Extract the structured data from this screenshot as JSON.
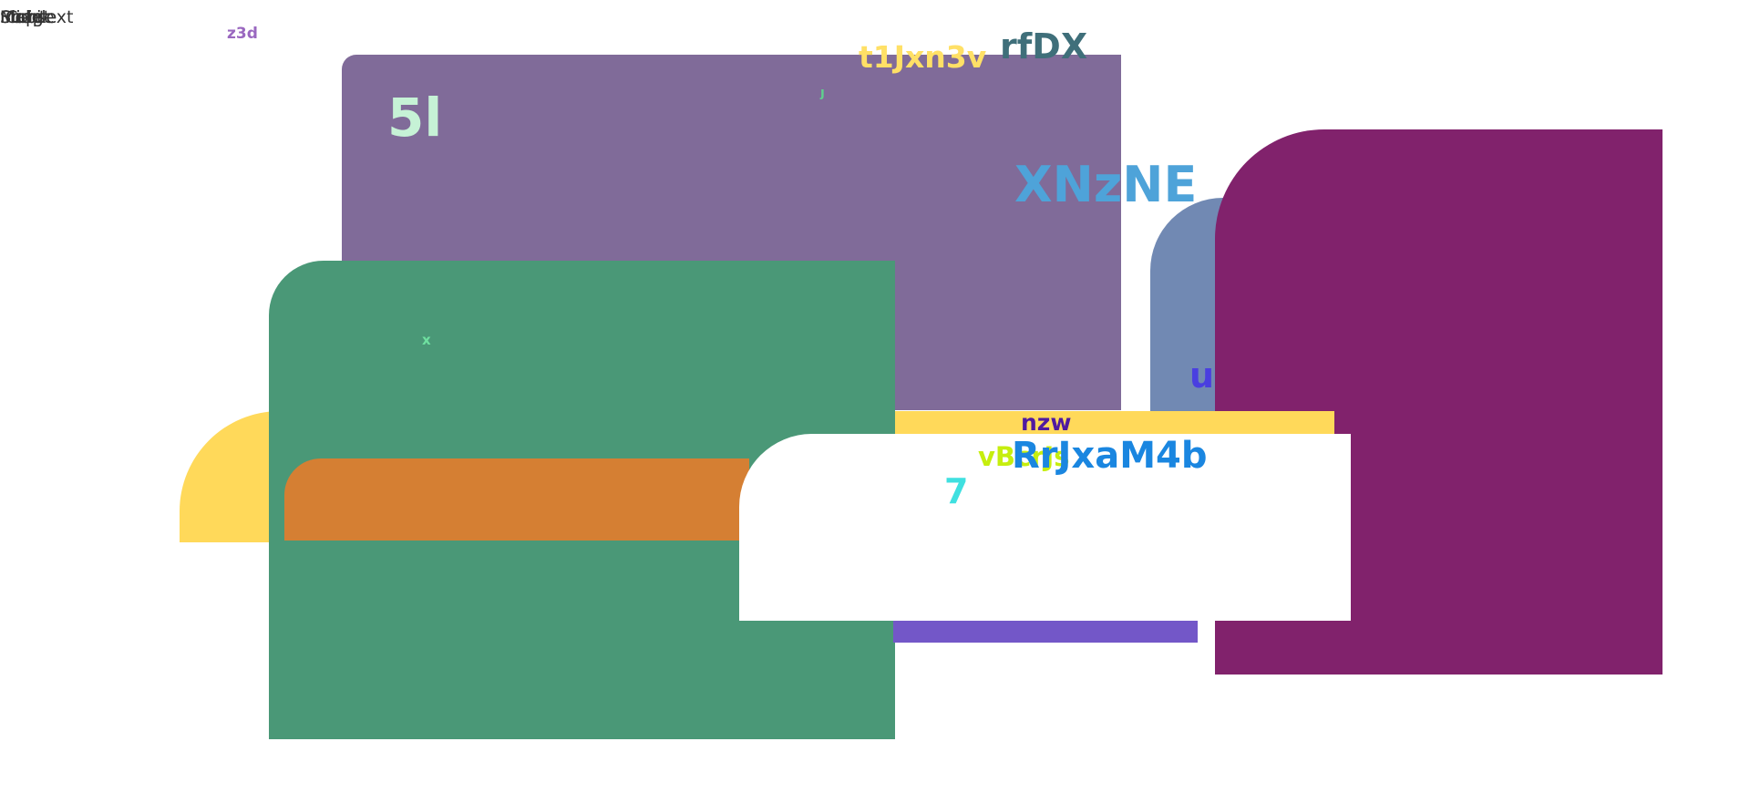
{
  "overlapping_labels": [
    "Image",
    "Maps",
    "Script",
    "Mobile",
    "Slide",
    "Context"
  ],
  "shape_colors": {
    "purple_panel": "#806b99",
    "steel_blue_panel": "#7189b3",
    "magenta_panel": "#81226c",
    "yellow_strip": "#ffd95a",
    "yellow_left": "#ffd95a",
    "green_panel": "#4a9877",
    "orange_strip": "#d57f33",
    "violet_bar": "#7357c8",
    "white_card": "#ffffff"
  },
  "labels": {
    "z3d": {
      "text": "z3d",
      "color": "#9a68c0"
    },
    "t1Jxn3v": {
      "text": "t1Jxn3v",
      "color": "#ffe066"
    },
    "rfDX": {
      "text": "rfDX",
      "color": "#3f6f7a"
    },
    "five_l": {
      "text": "5l",
      "color": "#c6f2d6"
    },
    "tiny_j": {
      "text": "ȷ",
      "color": "#5fd18e"
    },
    "XNzNE": {
      "text": "XNzNE",
      "color": "#4ea3d9"
    },
    "x": {
      "text": "x",
      "color": "#6fe0a0"
    },
    "u": {
      "text": "u",
      "color": "#4a3fe0"
    },
    "nzw": {
      "text": "nzw",
      "color": "#4f1aa0"
    },
    "vBcrJs": {
      "text": "vBcrJs",
      "color": "#c6ee0e"
    },
    "RrJxaM4b": {
      "text": "RrJxaM4b",
      "color": "#1a86e0"
    },
    "seven": {
      "text": "7",
      "color": "#3fe0e0"
    }
  }
}
